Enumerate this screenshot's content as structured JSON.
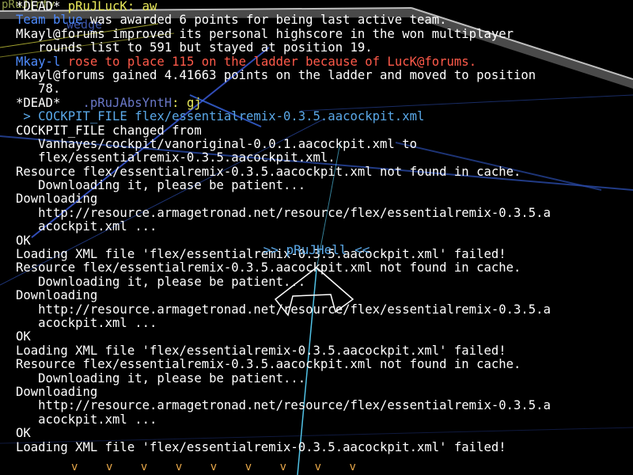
{
  "overlay": {
    "top_left_name": "pRuJ|rfy",
    "wedge_label": "wedge",
    "center_message": ">> pRuJHell <<",
    "chevron": "v"
  },
  "console": {
    "lines": [
      [
        {
          "t": "*DEAD* ",
          "c": "white"
        },
        {
          "t": "pRuJLucK: aw",
          "c": "yellow"
        }
      ],
      [
        {
          "t": "Team blue",
          "c": "blue"
        },
        {
          "t": " was awarded 6 points for being last active team.",
          "c": "white"
        }
      ],
      [
        {
          "t": "Mkayl@forums improved its personal highscore in the won multiplayer",
          "c": "white"
        }
      ],
      [
        {
          "t": "   rounds list to 591 but stayed at position 19.",
          "c": "white"
        }
      ],
      [
        {
          "t": "Mkay-l",
          "c": "blue"
        },
        {
          "t": " rose to place 115 on the ladder because of LucK@forums.",
          "c": "red"
        }
      ],
      [
        {
          "t": "Mkayl@forums gained 4.41663 points on the ladder and moved to position",
          "c": "white"
        }
      ],
      [
        {
          "t": "   78.",
          "c": "white"
        }
      ],
      [
        {
          "t": "*DEAD*  ",
          "c": "white"
        },
        {
          "t": " .pRuJAbsYntH",
          "c": "dimblue"
        },
        {
          "t": ": gj",
          "c": "yellow"
        }
      ],
      [
        {
          "t": " > COCKPIT_FILE flex/essentialremix-0.3.5.aacockpit.xml",
          "c": "cyan"
        }
      ],
      [
        {
          "t": "COCKPIT_FILE changed from",
          "c": "white"
        }
      ],
      [
        {
          "t": "   Vanhayes/cockpit/vanoriginal-0.0.1.aacockpit.xml to",
          "c": "white"
        }
      ],
      [
        {
          "t": "   flex/essentialremix-0.3.5.aacockpit.xml.",
          "c": "white"
        }
      ],
      [
        {
          "t": "Resource flex/essentialremix-0.3.5.aacockpit.xml not found in cache.",
          "c": "white"
        }
      ],
      [
        {
          "t": "   Downloading it, please be patient...",
          "c": "white"
        }
      ],
      [
        {
          "t": "Downloading",
          "c": "white"
        }
      ],
      [
        {
          "t": "   http://resource.armagetronad.net/resource/flex/essentialremix-0.3.5.a",
          "c": "white"
        }
      ],
      [
        {
          "t": "   acockpit.xml ...",
          "c": "white"
        }
      ],
      [
        {
          "t": "OK",
          "c": "white"
        }
      ],
      [
        {
          "t": "Loading XML file 'flex/essentialremix-0.3.5.aacockpit.xml' failed!",
          "c": "white"
        }
      ],
      [
        {
          "t": "Resource flex/essentialremix-0.3.5.aacockpit.xml not found in cache.",
          "c": "white"
        }
      ],
      [
        {
          "t": "   Downloading it, please be patient...",
          "c": "white"
        }
      ],
      [
        {
          "t": "Downloading",
          "c": "white"
        }
      ],
      [
        {
          "t": "   http://resource.armagetronad.net/resource/flex/essentialremix-0.3.5.a",
          "c": "white"
        }
      ],
      [
        {
          "t": "   acockpit.xml ...",
          "c": "white"
        }
      ],
      [
        {
          "t": "OK",
          "c": "white"
        }
      ],
      [
        {
          "t": "Loading XML file 'flex/essentialremix-0.3.5.aacockpit.xml' failed!",
          "c": "white"
        }
      ],
      [
        {
          "t": "Resource flex/essentialremix-0.3.5.aacockpit.xml not found in cache.",
          "c": "white"
        }
      ],
      [
        {
          "t": "   Downloading it, please be patient...",
          "c": "white"
        }
      ],
      [
        {
          "t": "Downloading",
          "c": "white"
        }
      ],
      [
        {
          "t": "   http://resource.armagetronad.net/resource/flex/essentialremix-0.3.5.a",
          "c": "white"
        }
      ],
      [
        {
          "t": "   acockpit.xml ...",
          "c": "white"
        }
      ],
      [
        {
          "t": "OK",
          "c": "white"
        }
      ],
      [
        {
          "t": "Loading XML file 'flex/essentialremix-0.3.5.aacockpit.xml' failed!",
          "c": "white"
        }
      ]
    ]
  },
  "colors": {
    "white": "#ffffff",
    "blue": "#4f8cff",
    "red": "#ff5a4a",
    "yellow": "#e8e85a",
    "cyan": "#5aa8e8",
    "dimblue": "#6a78c8",
    "grid_lines": "#2a4aa8",
    "wall_gray": "#9a9a9a",
    "chevron": "#e8a84a"
  }
}
